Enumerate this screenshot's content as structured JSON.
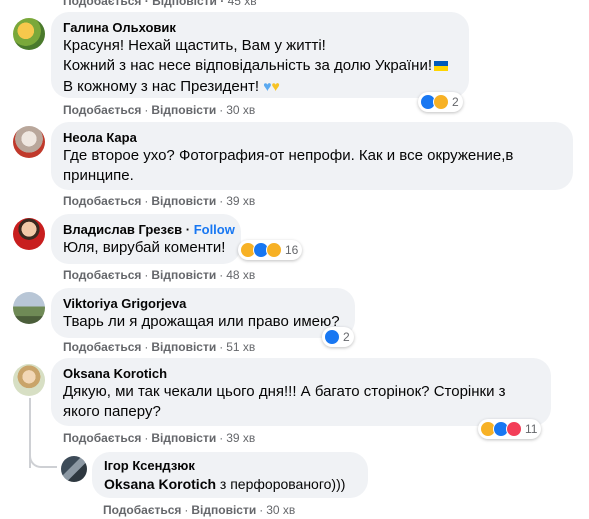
{
  "top": {
    "like": "Подобається",
    "reply": "Відповісти",
    "time": "45 хв"
  },
  "comments": [
    {
      "author": "Галина Ольховик",
      "lines": [
        "Красуня! Нехай щастить, Вам у житті!",
        "Кожний з нас несе відповідальність за долю України!",
        "В кожному з нас Президент!"
      ],
      "like": "Подобається",
      "reply": "Відповісти",
      "time": "30 хв",
      "reactions": "2"
    },
    {
      "author": "Неола Кара",
      "lines": [
        "Где второе ухо? Фотография-от непрофи. Как и все окружение,в",
        "принципе."
      ],
      "like": "Подобається",
      "reply": "Відповісти",
      "time": "39 хв"
    },
    {
      "author": "Владислав Грезєв",
      "follow": "Follow",
      "lines": [
        "Юля, вирубай коменти!"
      ],
      "like": "Подобається",
      "reply": "Відповісти",
      "time": "48 хв",
      "reactions": "16"
    },
    {
      "author": "Viktoriya Grigorjeva",
      "lines": [
        "Тварь ли я дрожащая или право имею?"
      ],
      "like": "Подобається",
      "reply": "Відповісти",
      "time": "51 хв",
      "reactions": "2"
    },
    {
      "author": "Oksana Korotich",
      "lines": [
        "Дякую, ми так чекали цього дня!!! А багато сторінок? Сторінки з",
        "якого паперу?"
      ],
      "like": "Подобається",
      "reply": "Відповісти",
      "time": "39 хв",
      "reactions": "11"
    },
    {
      "author": "Ігор Ксендзюк",
      "mention": "Oksana Korotich",
      "lines": [
        " з перфорованого)))"
      ],
      "like": "Подобається",
      "reply": "Відповісти",
      "time": "30 хв"
    }
  ],
  "colors": {
    "bubble": "#f0f2f5",
    "link": "#1877f2",
    "meta": "#65676b"
  }
}
